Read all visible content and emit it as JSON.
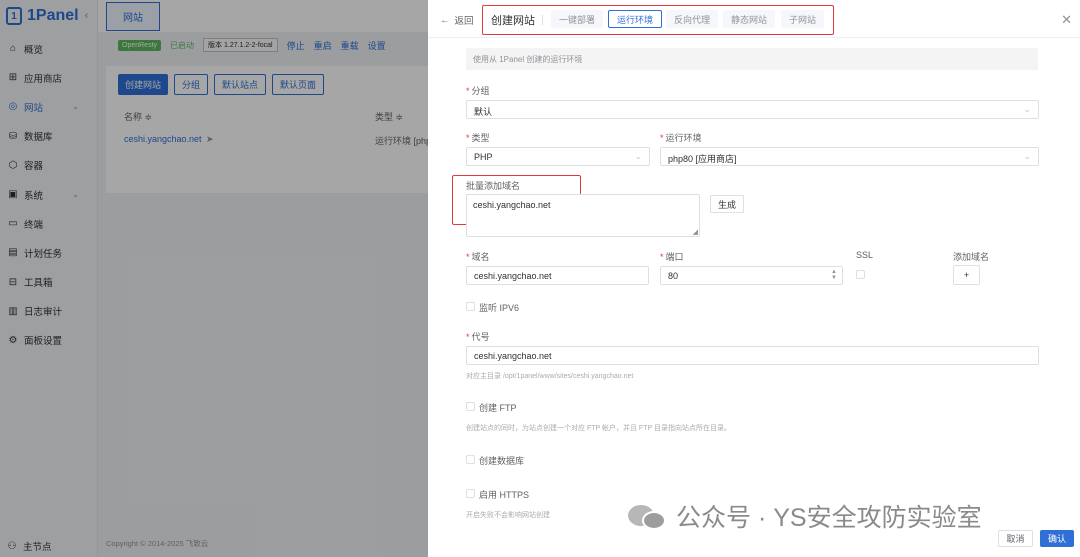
{
  "app": {
    "name": "1Panel",
    "collapse_glyph": "‹"
  },
  "sidebar": {
    "items": [
      {
        "label": "概览",
        "icon": "home-icon",
        "glyph": "⌂",
        "active": false,
        "expand": false
      },
      {
        "label": "应用商店",
        "icon": "grid-icon",
        "glyph": "⊞",
        "active": false,
        "expand": false
      },
      {
        "label": "网站",
        "icon": "globe-icon",
        "glyph": "◎",
        "active": true,
        "expand": true
      },
      {
        "label": "数据库",
        "icon": "database-icon",
        "glyph": "⛁",
        "active": false,
        "expand": false
      },
      {
        "label": "容器",
        "icon": "container-icon",
        "glyph": "⬡",
        "active": false,
        "expand": false
      },
      {
        "label": "系统",
        "icon": "system-icon",
        "glyph": "▣",
        "active": false,
        "expand": true
      },
      {
        "label": "终端",
        "icon": "terminal-icon",
        "glyph": "▭",
        "active": false,
        "expand": false
      },
      {
        "label": "计划任务",
        "icon": "calendar-icon",
        "glyph": "▤",
        "active": false,
        "expand": false
      },
      {
        "label": "工具箱",
        "icon": "toolbox-icon",
        "glyph": "⊟",
        "active": false,
        "expand": false
      },
      {
        "label": "日志审计",
        "icon": "log-icon",
        "glyph": "▥",
        "active": false,
        "expand": false
      },
      {
        "label": "面板设置",
        "icon": "settings-icon",
        "glyph": "⚙",
        "active": false,
        "expand": false
      }
    ],
    "footer": "主节点"
  },
  "topbar": {
    "tab": "网站"
  },
  "status": {
    "server": "OpenResty",
    "state": "已启动",
    "version": "版本 1.27.1.2-2-focal",
    "actions": [
      "停止",
      "重启",
      "重载",
      "设置"
    ]
  },
  "toolbar": {
    "create": "创建网站",
    "group": "分组",
    "default_site": "默认站点",
    "default_page": "默认页面"
  },
  "table": {
    "col_name": "名称 ≑",
    "col_type": "类型 ≑",
    "row_name": "ceshi.yangchao.net",
    "row_type": "运行环境 [php"
  },
  "footer": {
    "copyright": "Copyright © 2014-2025 飞致云"
  },
  "drawer": {
    "back": "返回",
    "title": "创建网站",
    "tabs": [
      {
        "label": "一键部署",
        "active": false
      },
      {
        "label": "运行环境",
        "active": true
      },
      {
        "label": "反向代理",
        "active": false
      },
      {
        "label": "静态网站",
        "active": false
      },
      {
        "label": "子网站",
        "active": false
      }
    ],
    "info": "使用从 1Panel 创建的运行环境",
    "group_label": "分组",
    "group_value": "默认",
    "type_label": "类型",
    "type_value": "PHP",
    "runtime_label": "运行环境",
    "runtime_value": "php80 [应用商店]",
    "batch_label": "批量添加域名",
    "batch_value": "ceshi.yangchao.net",
    "generate": "生成",
    "domain_label": "域名",
    "domain_value": "ceshi.yangchao.net",
    "port_label": "端口",
    "port_value": "80",
    "ssl_label": "SSL",
    "add_domain_label": "添加域名",
    "add_domain_btn": "+",
    "ipv6": "监听 IPV6",
    "alias_label": "代号",
    "alias_value": "ceshi.yangchao.net",
    "alias_hint": "对应主目录 /opt/1panel/www/sites/ceshi.yangchao.net",
    "ftp": "创建 FTP",
    "ftp_hint": "创建站点的同时，为站点创建一个对应 FTP 帐户，并且 FTP 目录指向站点所在目录。",
    "db": "创建数据库",
    "https": "启用 HTTPS",
    "https_hint": "开启失败不会影响网站创建",
    "cancel": "取消",
    "confirm": "确认"
  },
  "watermark": {
    "text": "公众号 · YS安全攻防实验室"
  },
  "colors": {
    "accent": "#2f6fd6",
    "highlight": "#e03a3a",
    "success": "#5cb85c"
  }
}
